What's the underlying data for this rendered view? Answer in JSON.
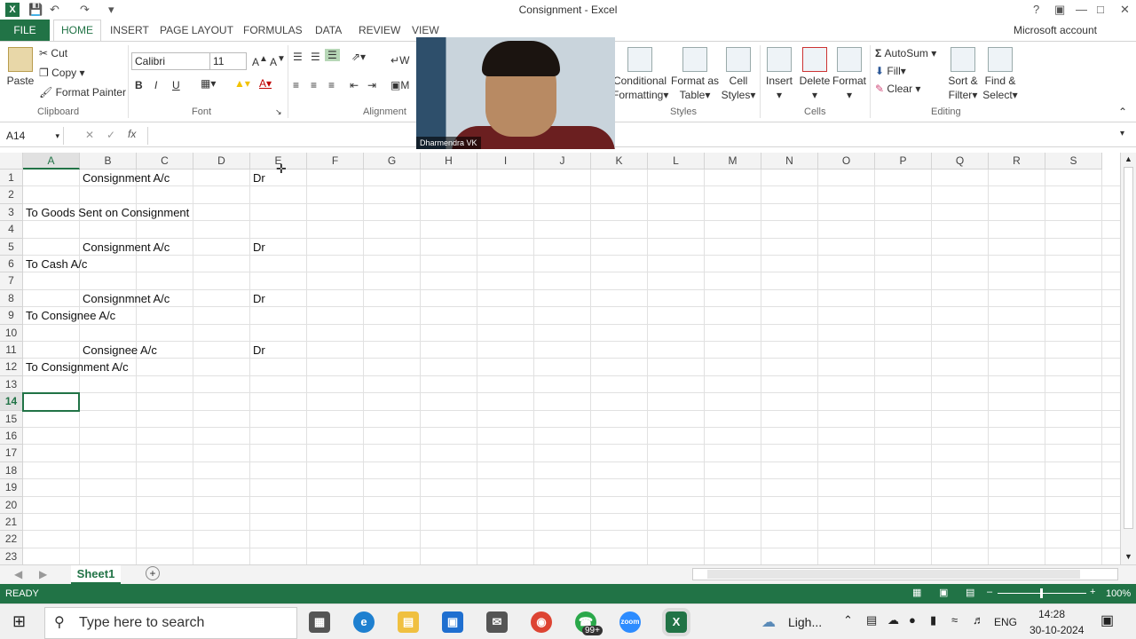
{
  "window": {
    "title": "Consignment - Excel",
    "help": "?"
  },
  "ribbon_tabs": {
    "file": "FILE",
    "home": "HOME",
    "insert": "INSERT",
    "page_layout": "PAGE LAYOUT",
    "formulas": "FORMULAS",
    "data": "DATA",
    "review": "REVIEW",
    "view": "VIEW",
    "account": "Microsoft account"
  },
  "clipboard": {
    "paste": "Paste",
    "cut": "Cut",
    "copy": "Copy",
    "format_painter": "Format Painter",
    "group": "Clipboard"
  },
  "font": {
    "name": "Calibri",
    "size": "11",
    "bold": "B",
    "italic": "I",
    "underline": "U",
    "group": "Font"
  },
  "alignment": {
    "wrap": "W",
    "merge": "M",
    "group": "Alignment"
  },
  "styles": {
    "conditional": "Conditional",
    "formatting": "Formatting",
    "format_as": "Format as",
    "table": "Table",
    "cell": "Cell",
    "cell_styles": "Styles",
    "group": "Styles"
  },
  "cells": {
    "insert": "Insert",
    "delete": "Delete",
    "format": "Format",
    "group": "Cells"
  },
  "editing": {
    "autosum": "AutoSum",
    "fill": "Fill",
    "clear": "Clear",
    "sort": "Sort &",
    "filter": "Filter",
    "find": "Find &",
    "select": "Select",
    "group": "Editing"
  },
  "formula_bar": {
    "name_box": "A14",
    "fx": "fx",
    "content": ""
  },
  "columns": [
    "A",
    "B",
    "C",
    "D",
    "E",
    "F",
    "G",
    "H",
    "I",
    "J",
    "K",
    "L",
    "M",
    "N",
    "O",
    "P",
    "Q",
    "R",
    "S"
  ],
  "rows": [
    "1",
    "2",
    "3",
    "4",
    "5",
    "6",
    "7",
    "8",
    "9",
    "10",
    "11",
    "12",
    "13",
    "14",
    "15",
    "16",
    "17",
    "18",
    "19",
    "20",
    "21",
    "22",
    "23"
  ],
  "cells_data": {
    "b1": "Consignment A/c",
    "e1": "Dr",
    "a3": "To Goods Sent on Consignment",
    "b5": "Consignment A/c",
    "e5": "Dr",
    "a6": "To Cash A/c",
    "b8": "Consignmnet A/c",
    "e8": "Dr",
    "a9": "To Consignee A/c",
    "b11": "Consignee A/c",
    "e11": "Dr",
    "a12": "To Consignment A/c"
  },
  "sheet": {
    "tab": "Sheet1",
    "add": "+"
  },
  "status": {
    "ready": "READY",
    "zoom": "100%"
  },
  "video": {
    "name": "Dharmendra VK"
  },
  "taskbar": {
    "search_placeholder": "Type here to search",
    "badge": "99+",
    "weather": "Ligh...",
    "lang": "ENG",
    "time": "14:28",
    "date": "30-10-2024"
  }
}
